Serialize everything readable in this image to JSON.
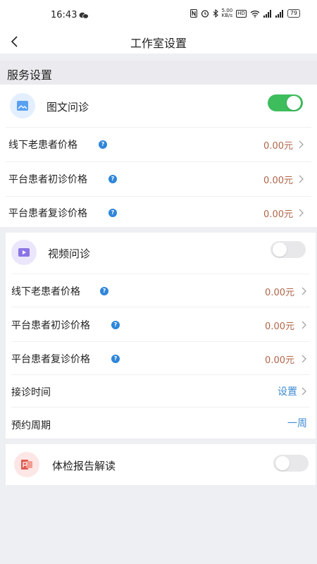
{
  "status_bar": {
    "time": "16:43",
    "net_speed_top": "5.00",
    "net_speed_bottom": "KB/s",
    "hd_label": "HD",
    "battery": "79"
  },
  "nav": {
    "title": "工作室设置"
  },
  "section": {
    "title": "服务设置"
  },
  "image_text_consult": {
    "label": "图文问诊",
    "enabled": true,
    "rows": [
      {
        "label": "线下老患者价格",
        "value": "0.00元"
      },
      {
        "label": "平台患者初诊价格",
        "value": "0.00元"
      },
      {
        "label": "平台患者复诊价格",
        "value": "0.00元"
      }
    ]
  },
  "video_consult": {
    "label": "视频问诊",
    "enabled": false,
    "rows": [
      {
        "label": "线下老患者价格",
        "value": "0.00元"
      },
      {
        "label": "平台患者初诊价格",
        "value": "0.00元"
      },
      {
        "label": "平台患者复诊价格",
        "value": "0.00元"
      }
    ],
    "schedule": {
      "label": "接诊时间",
      "value": "设置"
    },
    "booking_period": {
      "label": "预约周期",
      "value": "一周"
    }
  },
  "report_reading": {
    "label": "体检报告解读",
    "enabled": false
  },
  "colors": {
    "toggle_on": "#3dbd5c",
    "toggle_off": "#e8e8ea",
    "price": "#b0664a",
    "link": "#3f8bd1",
    "help": "#2f86d9"
  }
}
